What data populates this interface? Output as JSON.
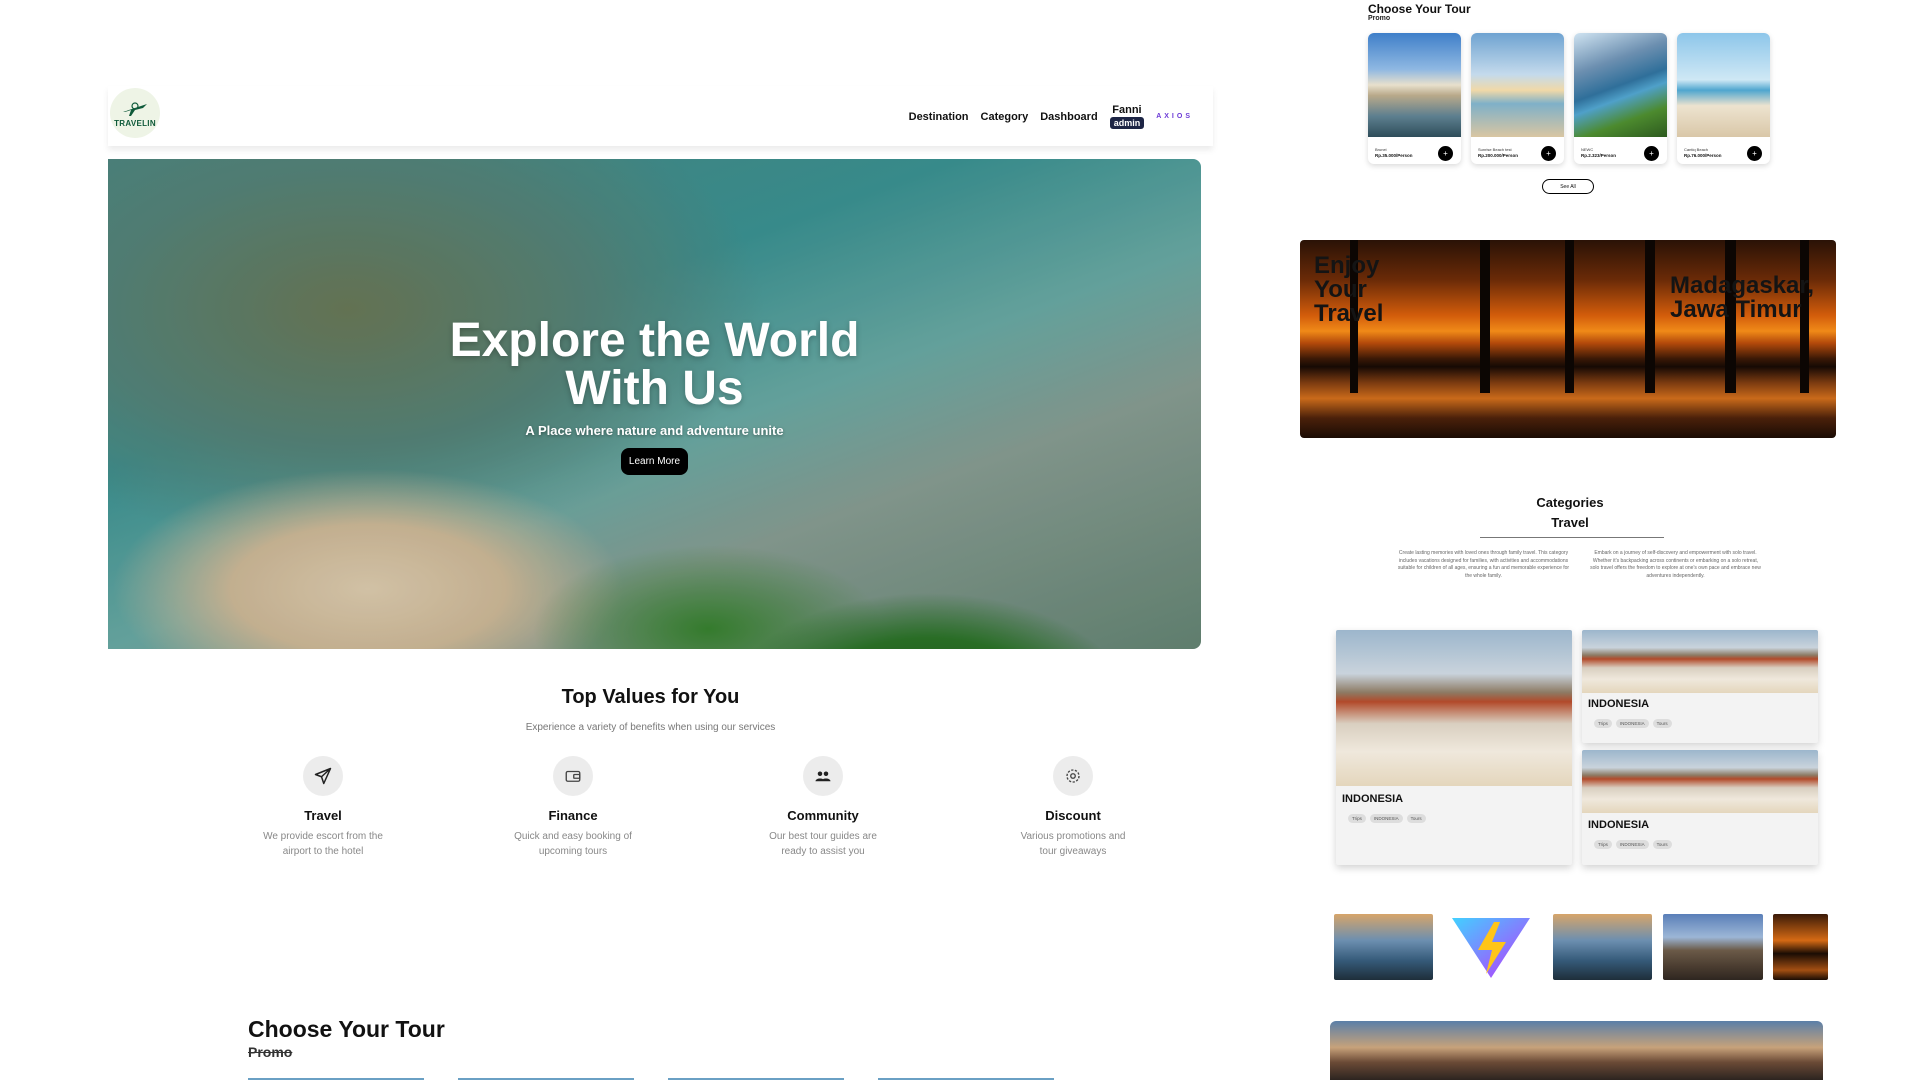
{
  "nav": {
    "logo_text": "TRAVELIN",
    "links": [
      "Destination",
      "Category",
      "Dashboard"
    ],
    "user_name": "Fanni",
    "user_role": "admin",
    "brand": "AXIOS"
  },
  "hero": {
    "title": "Explore the World With Us",
    "subtitle": "A Place where nature and adventure unite",
    "button": "Learn More"
  },
  "values": {
    "title": "Top Values for You",
    "subtitle": "Experience a variety of benefits when using our services",
    "items": [
      {
        "title": "Travel",
        "text": "We provide escort from the airport to the hotel",
        "icon": "send-icon"
      },
      {
        "title": "Finance",
        "text": "Quick and easy booking of upcoming tours",
        "icon": "wallet-icon"
      },
      {
        "title": "Community",
        "text": "Our best tour guides are ready to assist you",
        "icon": "people-icon"
      },
      {
        "title": "Discount",
        "text": "Various promotions and tour giveaways",
        "icon": "settings-icon"
      }
    ]
  },
  "choose": {
    "title": "Choose Your Tour",
    "promo": "Promo"
  },
  "right": {
    "choose_title": "Choose Your Tour",
    "choose_promo": "Promo",
    "tours": [
      {
        "name": "Brunei",
        "price": "Rp.35.000/Person"
      },
      {
        "name": "Sunrise Beach test",
        "price": "Rp.200.000/Person"
      },
      {
        "name": "NEWC",
        "price": "Rp.2.323/Person"
      },
      {
        "name": "Cantiq Beach",
        "price": "Rp.76.000/Person"
      }
    ],
    "see_all": "See All",
    "banner_left": "Enjoy Your Travel",
    "banner_right": "Madagaskar, Jawa Timur",
    "categories_title": "Categories",
    "categories_sub": "Travel",
    "desc_left": "Create lasting memories with loved ones through family travel. This category includes vacations designed for families, with activities and accommodations suitable for children of all ages, ensuring a fun and memorable experience for the whole family.",
    "desc_right": "Embark on a journey of self-discovery and empowerment with solo travel. Whether it's backpacking across continents or embarking on a solo retreat, solo travel offers the freedom to explore at one's own pace and embrace new adventures independently.",
    "destinations": [
      {
        "name": "INDONESIA",
        "tags": [
          "Trips",
          "INDONESIA",
          "Tours"
        ]
      },
      {
        "name": "INDONESIA",
        "tags": [
          "Trips",
          "INDONESIA",
          "Tours"
        ]
      },
      {
        "name": "INDONESIA",
        "tags": [
          "Trips",
          "INDONESIA",
          "Tours"
        ]
      }
    ]
  },
  "colors": {
    "accent_dark": "#1d2545",
    "button_black": "#000000",
    "brand_purple": "#6b3ad6"
  }
}
